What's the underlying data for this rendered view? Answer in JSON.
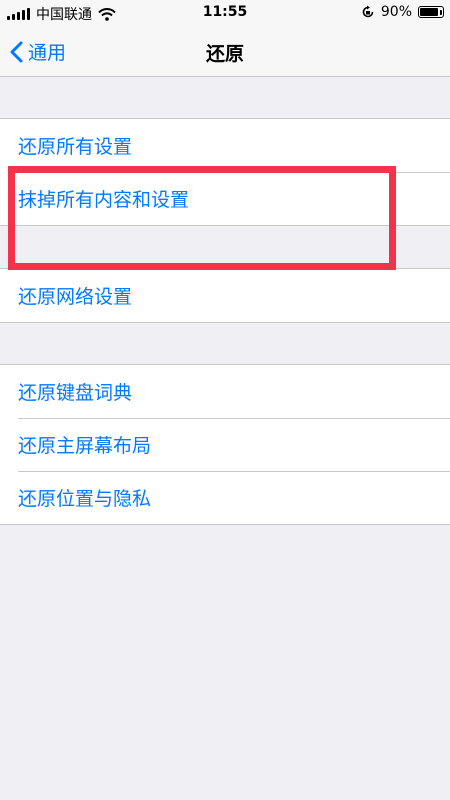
{
  "status_bar": {
    "carrier": "中国联通",
    "time": "11:55",
    "battery_percent": "90%",
    "battery_level": 0.9,
    "icons": [
      "signal-icon",
      "wifi-icon",
      "orientation-lock-icon",
      "battery-icon"
    ]
  },
  "nav": {
    "back_label": "通用",
    "title": "还原"
  },
  "groups": [
    {
      "items": [
        "还原所有设置",
        "抹掉所有内容和设置"
      ]
    },
    {
      "items": [
        "还原网络设置"
      ]
    },
    {
      "items": [
        "还原键盘词典",
        "还原主屏幕布局",
        "还原位置与隐私"
      ]
    }
  ],
  "colors": {
    "accent": "#007aff",
    "background": "#efeff4",
    "highlight": "#f2334c"
  }
}
